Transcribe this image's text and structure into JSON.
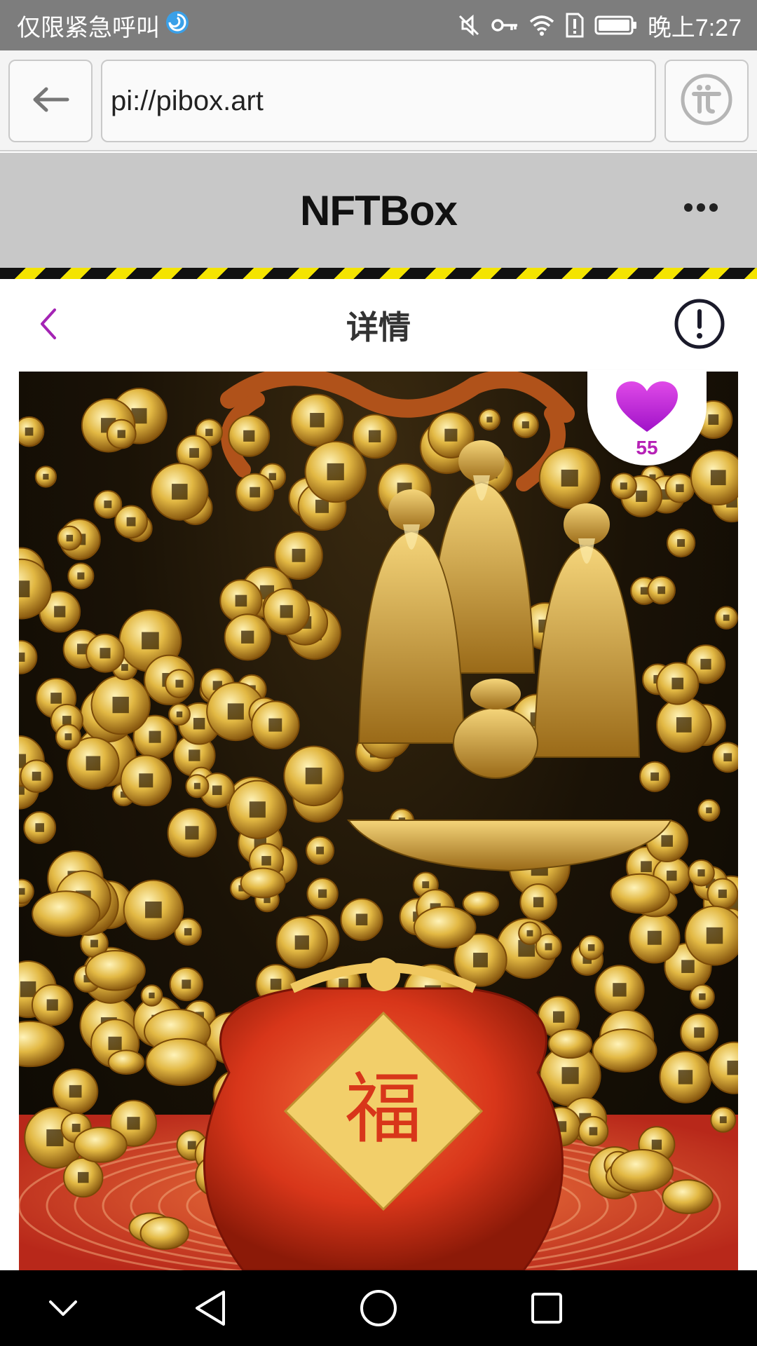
{
  "status_bar": {
    "carrier_text": "仅限紧急呼叫",
    "time": "晚上7:27",
    "icons": [
      "mute-icon",
      "key-icon",
      "wifi-icon",
      "sim-alert-icon",
      "battery-icon"
    ]
  },
  "browser": {
    "url": "pi://pibox.art",
    "back_icon": "arrow-left-icon",
    "pi_icon": "pi-logo-icon"
  },
  "app_header": {
    "title": "NFTBox",
    "more_icon": "more-dots-icon"
  },
  "detail": {
    "title": "详情",
    "back_icon": "chevron-left-icon",
    "info_icon": "info-exclamation-icon",
    "like_count": "55",
    "like_icon": "heart-icon",
    "image": {
      "description_icon": "nft-artwork-image",
      "bag_character": "福"
    }
  },
  "nav_bar": {
    "icons": [
      "chevron-down-icon",
      "back-triangle-icon",
      "home-circle-icon",
      "recents-square-icon"
    ]
  },
  "colors": {
    "status_bar": "#7d7d7d",
    "header": "#c8c8c8",
    "accent_purple": "#b622b6",
    "hazard_yellow": "#f4e400",
    "gold": "#d9a92a"
  }
}
